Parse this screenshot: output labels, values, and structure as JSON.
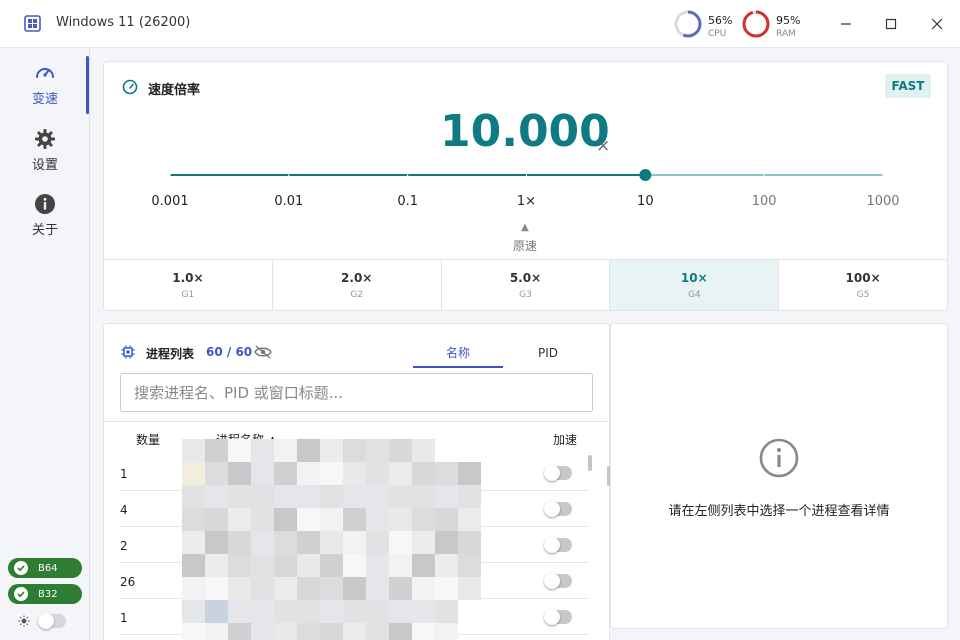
{
  "window": {
    "title": "Windows 11 (26200)",
    "cpu": {
      "value": "56%",
      "label": "CPU",
      "fraction": 0.56,
      "color": "#5c6bc0"
    },
    "ram": {
      "value": "95%",
      "label": "RAM",
      "fraction": 0.95,
      "color": "#d32f2f"
    }
  },
  "sidebar": {
    "items": [
      {
        "label": "变速",
        "icon": "speedometer-icon",
        "active": true
      },
      {
        "label": "设置",
        "icon": "gear-icon",
        "active": false
      },
      {
        "label": "关于",
        "icon": "info-icon",
        "active": false
      }
    ],
    "badges": [
      "B64",
      "B32"
    ],
    "theme_icon": "sun-icon"
  },
  "speed": {
    "title": "速度倍率",
    "mode_badge": "FAST",
    "value": "10.000",
    "unit": "×",
    "ticks": [
      "0.001",
      "0.01",
      "0.1",
      "1×",
      "10",
      "100",
      "1000"
    ],
    "current_tick_index": 4,
    "origin_marker": "▲",
    "origin_label": "原速",
    "presets": [
      {
        "value": "1.0×",
        "key": "G1",
        "active": false
      },
      {
        "value": "2.0×",
        "key": "G2",
        "active": false
      },
      {
        "value": "5.0×",
        "key": "G3",
        "active": false
      },
      {
        "value": "10×",
        "key": "G4",
        "active": true
      },
      {
        "value": "100×",
        "key": "G5",
        "active": false
      }
    ],
    "accent": "#0f7a82"
  },
  "process_list": {
    "title": "进程列表",
    "count": "60 / 60",
    "tabs": [
      {
        "label": "名称",
        "active": true
      },
      {
        "label": "PID",
        "active": false
      }
    ],
    "search_placeholder": "搜索进程名、PID 或窗口标题...",
    "columns": {
      "count": "数量",
      "name": "进程名称 ▲",
      "accelerate": "加速"
    },
    "rows": [
      {
        "count": "1",
        "accelerate": false
      },
      {
        "count": "4",
        "accelerate": false
      },
      {
        "count": "2",
        "accelerate": false
      },
      {
        "count": "26",
        "accelerate": false
      },
      {
        "count": "1",
        "accelerate": false
      }
    ]
  },
  "detail": {
    "empty_text": "请在左侧列表中选择一个进程查看详情"
  }
}
